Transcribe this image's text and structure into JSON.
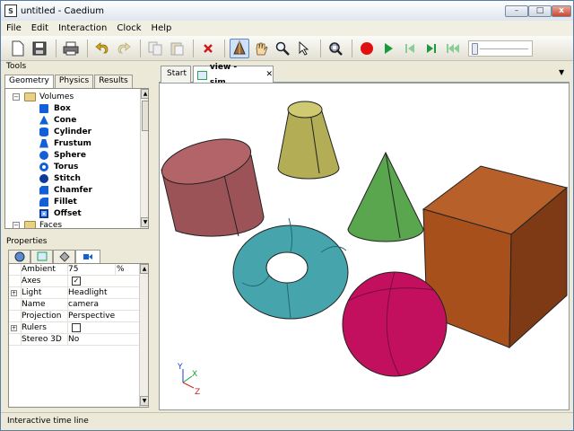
{
  "window": {
    "title": "untitled - Caedium",
    "icon_letter": "S"
  },
  "menu": [
    "File",
    "Edit",
    "Interaction",
    "Clock",
    "Help"
  ],
  "toolbar": {
    "icons": [
      "new-file-icon",
      "save-icon",
      "print-icon",
      "undo-icon",
      "redo-icon",
      "copy-icon",
      "paste-icon",
      "delete-icon",
      "select-geometry-icon",
      "pan-hand-icon",
      "zoom-icon",
      "pointer-icon",
      "zoom-fit-icon",
      "record-icon",
      "play-icon",
      "step-back-icon",
      "step-forward-icon",
      "rewind-icon"
    ],
    "active": "select-geometry-icon",
    "colors": {
      "record": "#e01010",
      "play": "#1a9a3a"
    }
  },
  "tools": {
    "header": "Tools",
    "tabs": [
      "Geometry",
      "Physics",
      "Results"
    ],
    "active_tab": "Geometry",
    "tree": {
      "group": "Volumes",
      "items": [
        "Box",
        "Cone",
        "Cylinder",
        "Frustum",
        "Sphere",
        "Torus",
        "Stitch",
        "Chamfer",
        "Fillet",
        "Offset"
      ],
      "next_group": "Faces"
    }
  },
  "properties": {
    "header": "Properties",
    "rows": [
      {
        "name": "Ambient",
        "value": "75",
        "extra": "%"
      },
      {
        "name": "Axes",
        "checked": true
      },
      {
        "name": "Light",
        "value": "Headlight",
        "expandable": true
      },
      {
        "name": "Name",
        "value": "camera"
      },
      {
        "name": "Projection",
        "value": "Perspective"
      },
      {
        "name": "Rulers",
        "checked": false,
        "expandable": true
      },
      {
        "name": "Stereo 3D",
        "value": "No"
      }
    ]
  },
  "view": {
    "tabs": [
      "Start",
      "view - sim"
    ],
    "active_tab": "view - sim",
    "axes": {
      "y": "Y",
      "x": "X",
      "z": "Z"
    },
    "colors": {
      "cylinder": "#a85a5e",
      "frustum": "#b3ae55",
      "cone": "#5aa64e",
      "box": "#a8501c",
      "torus": "#45a4ac",
      "sphere": "#c2105e"
    }
  },
  "status": "Interactive time line"
}
